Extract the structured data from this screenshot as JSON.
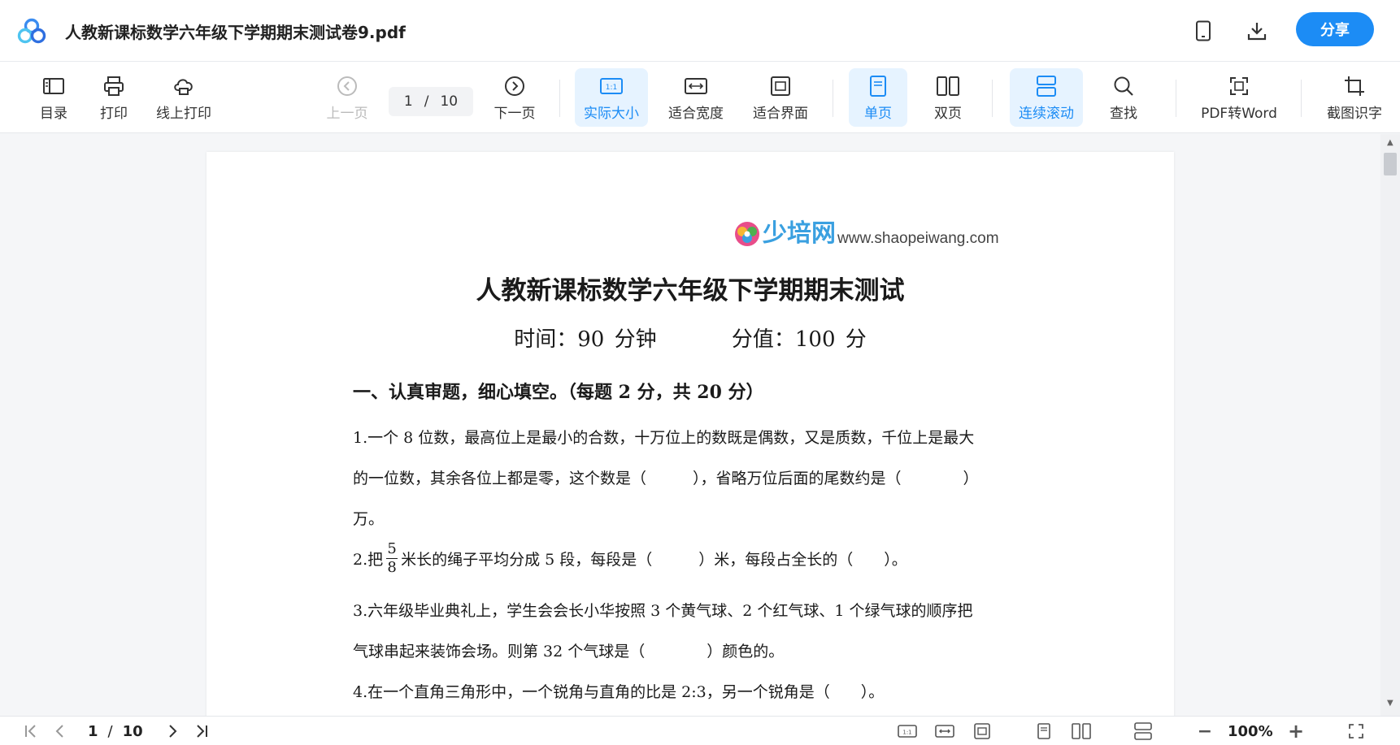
{
  "header": {
    "title": "人教新课标数学六年级下学期期末测试卷9.pdf",
    "share_label": "分享",
    "icons": [
      "app-logo-icon",
      "phone-icon",
      "download-icon"
    ],
    "accent_color": "#1c8cf5"
  },
  "toolbar": {
    "toc": "目录",
    "print": "打印",
    "online_print": "线上打印",
    "prev_page": "上一页",
    "current_page": "1",
    "page_sep": "/",
    "total_pages": "10",
    "next_page": "下一页",
    "actual_size": "实际大小",
    "fit_width": "适合宽度",
    "fit_screen": "适合界面",
    "single_page": "单页",
    "double_page": "双页",
    "continuous_scroll": "连续滚动",
    "find": "查找",
    "pdf_to_word": "PDF转Word",
    "screenshot_ocr": "截图识字",
    "ratio_icon_text": "1:1"
  },
  "document": {
    "site_brand": "少培网",
    "site_url": "www.shaopeiwang.com",
    "title": "人教新课标数学六年级下学期期末测试",
    "time": "时间：90 分钟",
    "score": "分值：100 分",
    "section_1": "一、认真审题，细心填空。（每题 2 分，共 20 分）",
    "q1_line1": "1.一个 8 位数，最高位上是最小的合数，十万位上的数既是偶数，又是质数，千位上是最大",
    "q1_line2": "的一位数，其余各位上都是零，这个数是（　　　），省略万位后面的尾数约是（　　　　）",
    "q1_line3": "万。",
    "q2_prefix": "2.把",
    "q2_num": "5",
    "q2_den": "8",
    "q2_suffix": "米长的绳子平均分成 5 段，每段是（　　　）米，每段占全长的（　　）。",
    "q3_line1": "3.六年级毕业典礼上，学生会会长小华按照 3 个黄气球、2 个红气球、1 个绿气球的顺序把",
    "q3_line2": "气球串起来装饰会场。则第 32 个气球是（　　　　）颜色的。",
    "q4_line1": "4.在一个直角三角形中，一个锐角与直角的比是 2:3，另一个锐角是（　　）。"
  },
  "statusbar": {
    "current_page": "1",
    "sep": "/",
    "total_pages": "10",
    "zoom": "100%",
    "zoom_out": "−",
    "zoom_in": "+",
    "ratio_icon_text": "1:1"
  }
}
